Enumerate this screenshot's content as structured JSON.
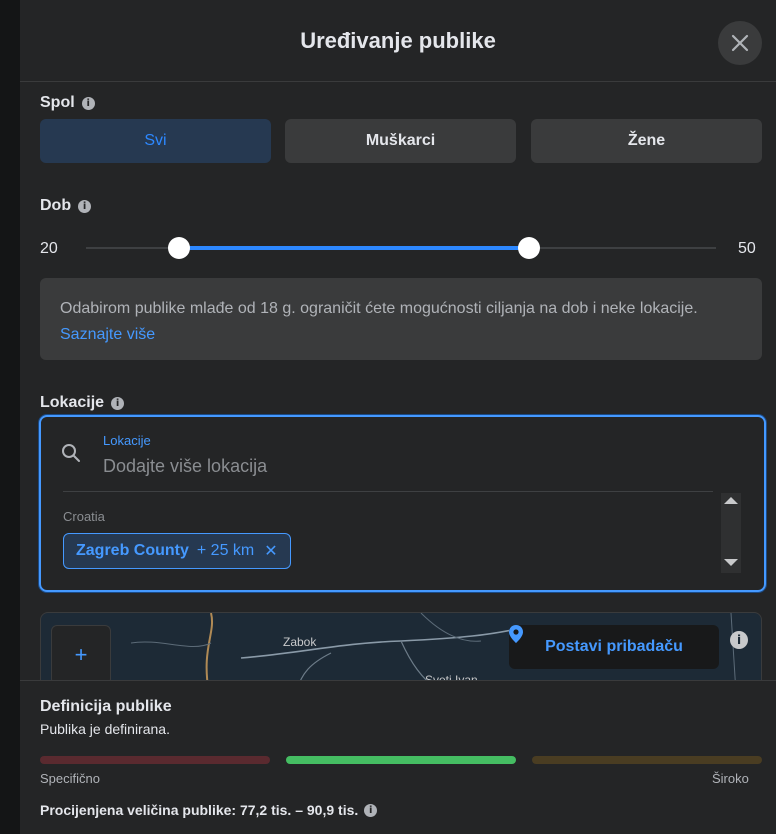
{
  "dialog": {
    "title": "Uređivanje publike"
  },
  "gender": {
    "label": "Spol",
    "options": [
      "Svi",
      "Muškarci",
      "Žene"
    ],
    "selected": "Svi"
  },
  "age": {
    "label": "Dob",
    "min": "20",
    "max": "50",
    "range_min": 18,
    "range_max": 65
  },
  "notice": {
    "text": "Odabirom publike mlađe od 18 g. ograničit ćete mogućnosti ciljanja na dob i neke lokacije.",
    "link": "Saznajte više"
  },
  "locations": {
    "label": "Lokacije",
    "field_label": "Lokacije",
    "placeholder": "Dodajte više lokacija",
    "country": "Croatia",
    "chip_name": "Zagreb County",
    "chip_radius": "+ 25 km",
    "chip_remove": "✕"
  },
  "map": {
    "zoom_in": "+",
    "place_1": "Zabok",
    "place_2": "Sveti Ivan",
    "pin_button": "Postavi pribadaču"
  },
  "audience": {
    "title": "Definicija publike",
    "status": "Publika je definirana.",
    "specific_label": "Specifično",
    "broad_label": "Široko",
    "estimate": "Procijenjena veličina publike: 77,2 tis. – 90,9 tis.",
    "meter_colors": [
      "#5a2a2f",
      "#45bd62",
      "#4a3d22"
    ],
    "active_segment": 2
  },
  "icons": {
    "close": "close-icon",
    "info": "info-icon",
    "search": "search-icon",
    "pin": "map-pin-icon"
  },
  "colors": {
    "accent": "#2d88ff",
    "link": "#4599ff",
    "dialog_bg": "#242526"
  }
}
